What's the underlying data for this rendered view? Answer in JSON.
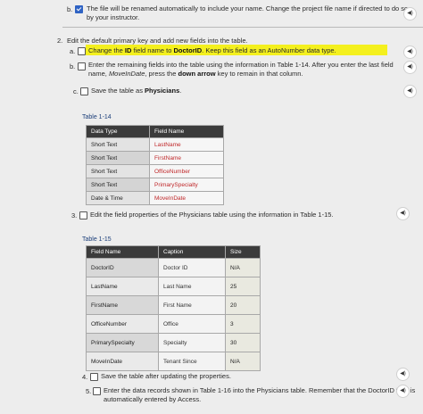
{
  "step_b_top": {
    "number": "b.",
    "checked": true,
    "line1": "The file will be renamed automatically to include your name. Change the project file name if directed to do so",
    "line2": "by your instructor."
  },
  "step_2": {
    "number": "2.",
    "text": "Edit the default primary key and add new fields into the table."
  },
  "step_2a": {
    "number": "a.",
    "prefix": "Change the ",
    "bold1": "ID",
    "middle": " field name to ",
    "bold2": "DoctorID",
    "suffix": ". Keep this field as an AutoNumber data type."
  },
  "step_2b": {
    "number": "b.",
    "line1": "Enter the remaining fields into the table using the information in Table 1-14. After you enter the last field",
    "line2_prefix": "name, ",
    "line2_italic": "MoveInDate",
    "line2_middle": ", press the ",
    "line2_bold": "down arrow",
    "line2_suffix": " key to remain in that column."
  },
  "step_2c": {
    "number": "c.",
    "prefix": "Save the table as ",
    "bold": "Physicians",
    "suffix": "."
  },
  "table_1_14": {
    "caption": "Table 1-14",
    "headers": [
      "Data Type",
      "Field Name"
    ],
    "rows": [
      [
        "Short Text",
        "LastName"
      ],
      [
        "Short Text",
        "FirstName"
      ],
      [
        "Short Text",
        "OfficeNumber"
      ],
      [
        "Short Text",
        "PrimarySpecialty"
      ],
      [
        "Date & Time",
        "MoveInDate"
      ]
    ]
  },
  "step_3": {
    "number": "3.",
    "text": "Edit the field properties of the Physicians table using the information in Table 1-15."
  },
  "table_1_15": {
    "caption": "Table 1-15",
    "headers": [
      "Field Name",
      "Caption",
      "Size"
    ],
    "rows": [
      [
        "DoctorID",
        "Doctor ID",
        "N/A"
      ],
      [
        "LastName",
        "Last Name",
        "25"
      ],
      [
        "FirstName",
        "First Name",
        "20"
      ],
      [
        "OfficeNumber",
        "Office",
        "3"
      ],
      [
        "PrimarySpecialty",
        "Specialty",
        "30"
      ],
      [
        "MoveInDate",
        "Tenant Since",
        "N/A"
      ]
    ]
  },
  "step_4": {
    "number": "4.",
    "text": "Save the table after updating the properties."
  },
  "step_5": {
    "number": "5.",
    "line1": "Enter the data records shown in Table 1-16 into the Physicians table. Remember that the DoctorID field is",
    "line2": "automatically entered by Access."
  },
  "audio_icon": "speaker-icon"
}
